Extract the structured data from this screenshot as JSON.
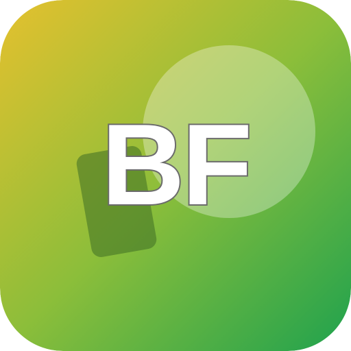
{
  "icon": {
    "monogram": "BF",
    "colors": {
      "gradient_start": "#E5C12E",
      "gradient_mid": "#8CBE3A",
      "gradient_end": "#1FA24E",
      "circle": "#FFFFFF",
      "card": "#3E6E25",
      "letter_fill": "#FFFFFF",
      "letter_outline": "#6B6B6B"
    }
  }
}
